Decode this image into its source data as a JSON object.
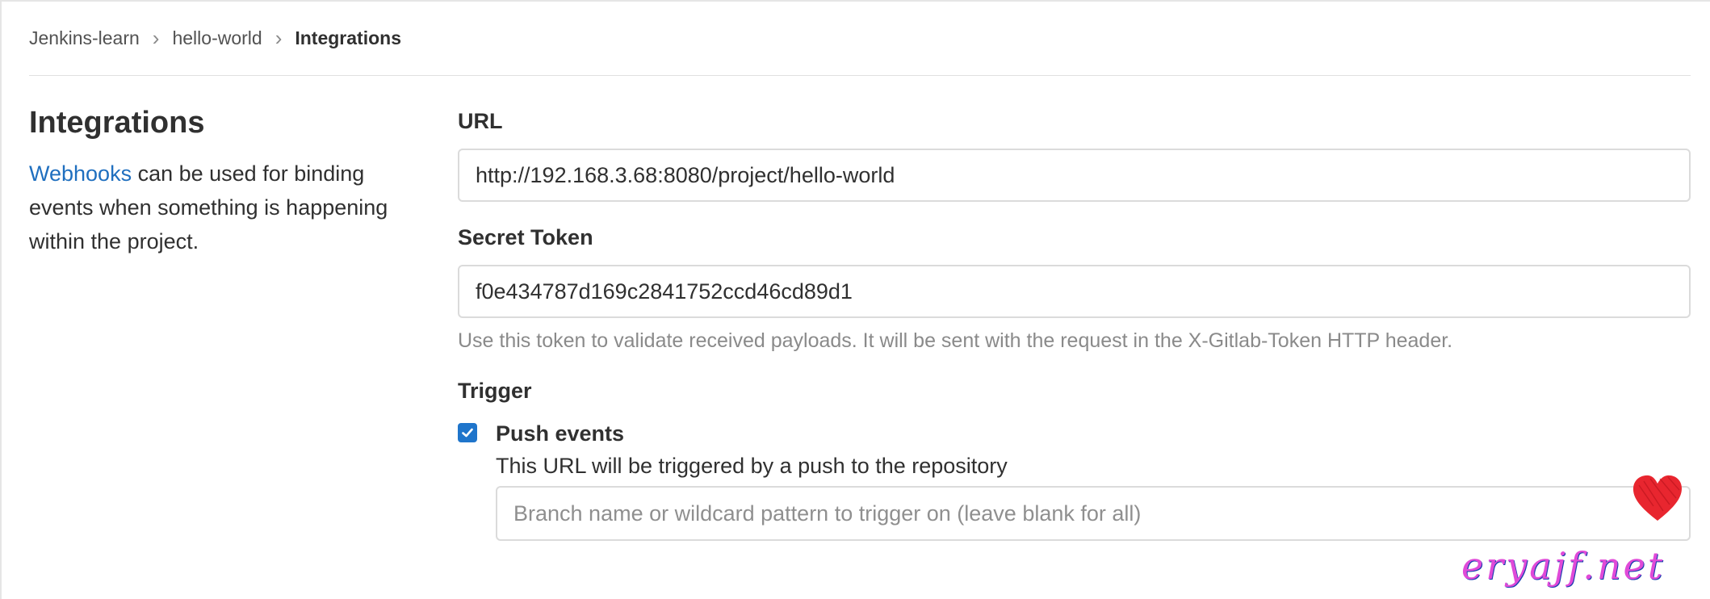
{
  "breadcrumb": {
    "items": [
      "Jenkins-learn",
      "hello-world",
      "Integrations"
    ]
  },
  "sidebar": {
    "title": "Integrations",
    "link_text": "Webhooks",
    "description": " can be used for binding events when something is happening within the project."
  },
  "form": {
    "url": {
      "label": "URL",
      "value": "http://192.168.3.68:8080/project/hello-world"
    },
    "secret_token": {
      "label": "Secret Token",
      "value": "f0e434787d169c2841752ccd46cd89d1",
      "help": "Use this token to validate received payloads. It will be sent with the request in the X-Gitlab-Token HTTP header."
    },
    "trigger": {
      "label": "Trigger",
      "push_events": {
        "checked": true,
        "label": "Push events",
        "description": "This URL will be triggered by a push to the repository",
        "branch_placeholder": "Branch name or wildcard pattern to trigger on (leave blank for all)"
      }
    }
  },
  "watermark": {
    "text": "eryajf.net"
  },
  "colors": {
    "link": "#1f6fbf",
    "checkbox": "#1f75cb",
    "heart": "#e8262f",
    "watermark_text": "#e04ad8"
  }
}
